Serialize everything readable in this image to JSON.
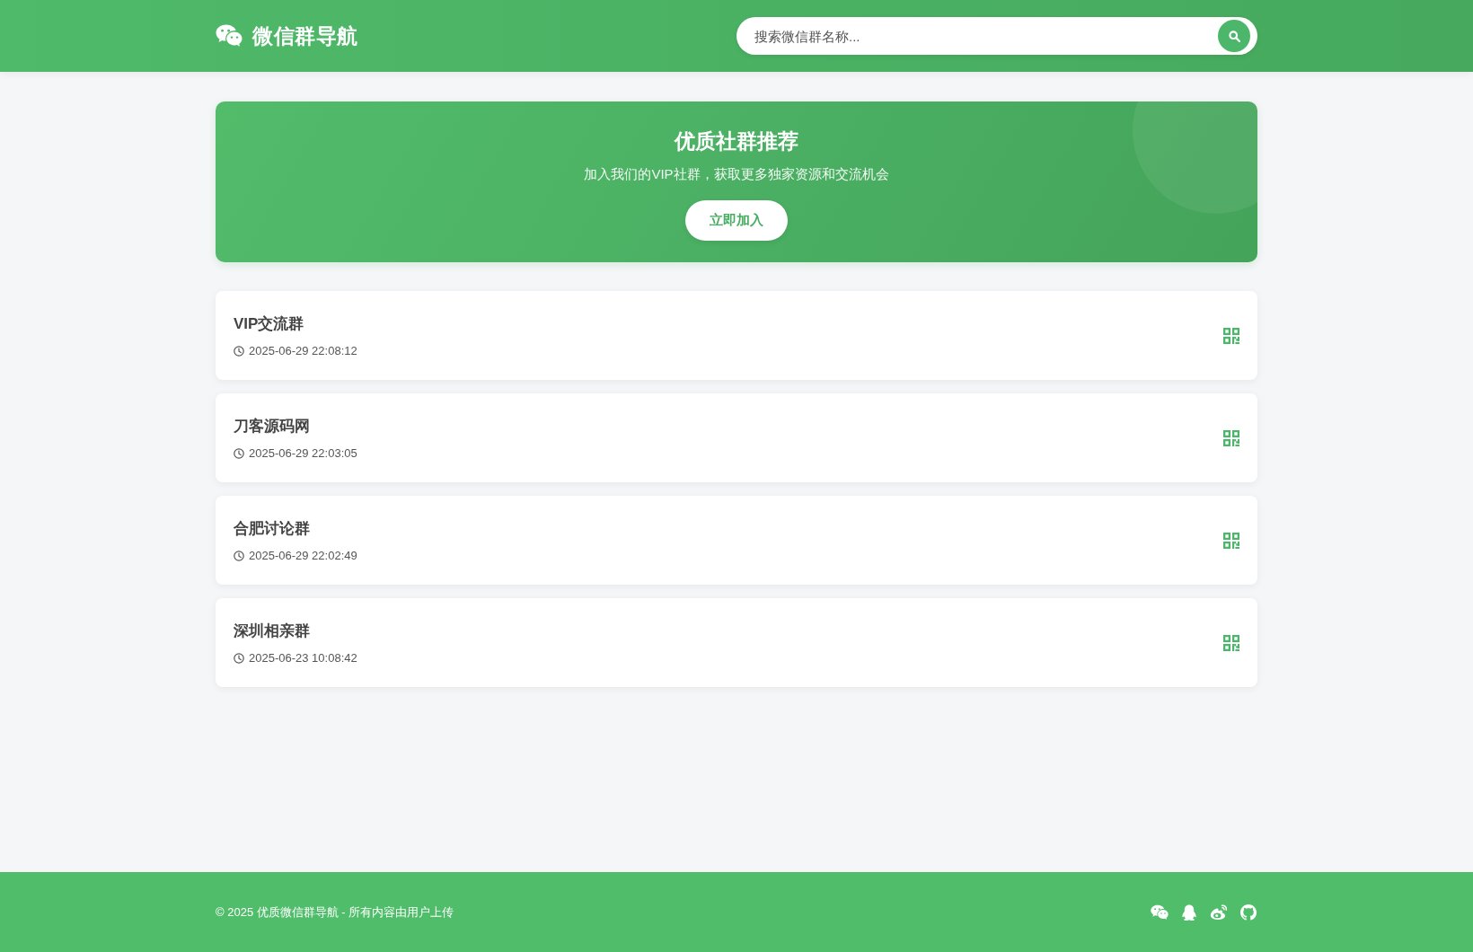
{
  "header": {
    "title": "微信群导航",
    "search": {
      "placeholder": "搜索微信群名称..."
    }
  },
  "banner": {
    "title": "优质社群推荐",
    "subtitle": "加入我们的VIP社群，获取更多独家资源和交流机会",
    "button": "立即加入"
  },
  "groups": [
    {
      "name": "VIP交流群",
      "time": "2025-06-29 22:08:12"
    },
    {
      "name": "刀客源码网",
      "time": "2025-06-29 22:03:05"
    },
    {
      "name": "合肥讨论群",
      "time": "2025-06-29 22:02:49"
    },
    {
      "name": "深圳相亲群",
      "time": "2025-06-23 10:08:42"
    }
  ],
  "footer": {
    "copyright": "© 2025 优质微信群导航 - 所有内容由用户上传"
  }
}
